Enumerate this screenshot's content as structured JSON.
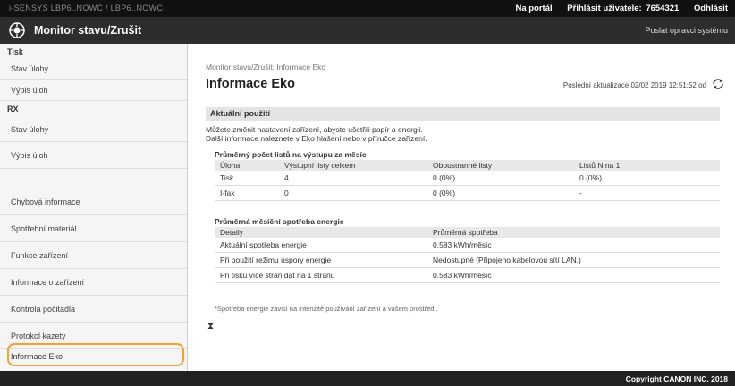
{
  "topbar": {
    "device": "i-SENSYS  LBP6..NOWC / LBP6..NOWC",
    "portal": "Na portál",
    "login": "Přihlásit uživatele:",
    "user_id": "7654321",
    "logout": "Odhlásit"
  },
  "header": {
    "title": "Monitor stavu/Zrušit",
    "send_link": "Poslat opravci systému"
  },
  "sidebar": {
    "print_heading": "Tisk",
    "print_items": [
      {
        "label": "Stav úlohy"
      },
      {
        "label": "Výpis úloh"
      }
    ],
    "fax_heading": "RX",
    "fax_items": [
      {
        "label": "Stav úlohy"
      },
      {
        "label": "Výpis úloh"
      }
    ],
    "items": [
      {
        "label": "Chybová informace"
      },
      {
        "label": "Spotřební materiál"
      },
      {
        "label": "Funkce zařízení"
      },
      {
        "label": "Informace o zařízení"
      },
      {
        "label": "Kontrola počitadla"
      },
      {
        "label": "Protokol kazety"
      },
      {
        "label": "Informace Eko"
      }
    ],
    "highlight_color": "#f5a02a"
  },
  "main": {
    "breadcrumb": "Monitor stavu/Zrušit: Informace Eko",
    "title": "Informace Eko",
    "last_update": "Poslední aktualizace 02/02 2019 12:51:52 od",
    "section": "Aktuální použití",
    "desc_line1": "Můžete změnit nastavení zařízení, abyste ušetřili papír a energii.",
    "desc_line2": "Další informace naleznete v Eko hlášení nebo v příručce zařízení.",
    "pages_heading": "Průměrný počet listů na výstupu za měsíc",
    "pages_table": {
      "headers": [
        "Úloha",
        "Výstupní listy celkem",
        "Oboustranné listy",
        "Listů N na 1"
      ],
      "rows": [
        [
          "Tisk",
          "4",
          "0 (0%)",
          "0 (0%)"
        ],
        [
          "I-fax",
          "0",
          "0 (0%)",
          "-"
        ]
      ]
    },
    "energy_heading": "Průměrná měsíční spotřeba energie",
    "energy_table": {
      "headers": [
        "Detaily",
        "Průměrná spotřeba"
      ],
      "rows": [
        [
          "Aktuální spotřeba energie",
          "0.583 kWh/měsíc"
        ],
        [
          "Při použití režimu úspory energie",
          "Nedostupné (Připojeno kabelovou sítí LAN.)"
        ],
        [
          "Při tisku více stran dat na 1 stranu",
          "0.583 kWh/měsíc"
        ]
      ]
    },
    "note": "*Spotřeba energie závisí na intenzitě používání zařízení a vašem prostředí.",
    "top_link": "⧗"
  },
  "footer": {
    "copyright": "Copyright CANON INC. 2018"
  }
}
